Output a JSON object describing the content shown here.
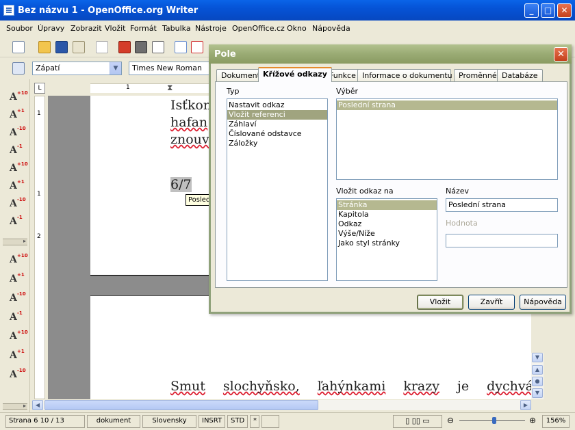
{
  "window": {
    "title": "Bez názvu 1 - OpenOffice.org Writer",
    "minimize": "_",
    "maximize": "□",
    "close": "✕"
  },
  "menu": [
    "Soubor",
    "Úpravy",
    "Zobrazit",
    "Vložit",
    "Formát",
    "Tabulka",
    "Nástroje",
    "OpenOffice.cz",
    "Okno",
    "Nápověda"
  ],
  "formatting": {
    "style": "Zápatí",
    "font": "Times New Roman"
  },
  "document": {
    "page1_lines": [
      "Isťkon",
      "hafan",
      "znouv"
    ],
    "page_field": "6/7",
    "tooltip": "Poslední strana",
    "page2_words": [
      "Smut",
      "slochyňsko,",
      "ľahýnkami",
      "krazy",
      "je",
      "dychvá"
    ]
  },
  "ruler": {
    "h_numbers": [
      "1"
    ],
    "v_numbers": [
      "1",
      "1",
      "2"
    ]
  },
  "dialog": {
    "title": "Pole",
    "tabs": [
      "Dokument",
      "Křížové odkazy",
      "Funkce",
      "Informace o dokumentu",
      "Proměnné",
      "Databáze"
    ],
    "active_tab": "Křížové odkazy",
    "type_label": "Typ",
    "type_items": [
      "Nastavit odkaz",
      "Vložit referenci",
      "Záhlaví",
      "Číslované odstavce",
      "Záložky"
    ],
    "type_selected": "Vložit referenci",
    "selection_label": "Výběr",
    "selection_items": [
      "Poslední strana"
    ],
    "insert_ref_label": "Vložit odkaz na",
    "insert_ref_items": [
      "Stránka",
      "Kapitola",
      "Odkaz",
      "Výše/Níže",
      "Jako styl stránky"
    ],
    "insert_ref_selected": "Stránka",
    "name_label": "Název",
    "name_value": "Poslední strana",
    "value_label": "Hodnota",
    "value_value": "",
    "buttons": {
      "insert": "Vložit",
      "close": "Zavřít",
      "help": "Nápověda"
    }
  },
  "statusbar": {
    "page": "Strana 6   10 / 13",
    "style": "dokument",
    "language": "Slovensky",
    "insert_mode": "INSRT",
    "selection_mode": "STD",
    "modified": "*",
    "zoom": "156%"
  },
  "colors": {
    "title_bar": "#0553d6",
    "dialog_title": "#9aab74",
    "selection": "#a0a47f",
    "active_tab_accent": "#e68b2c"
  }
}
